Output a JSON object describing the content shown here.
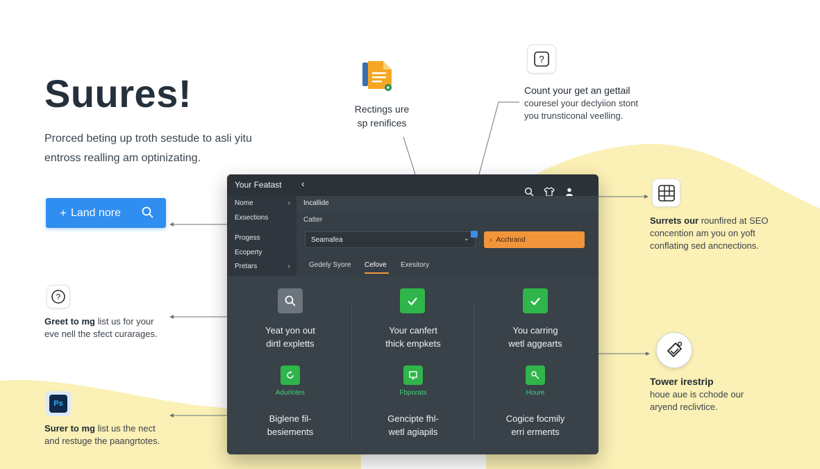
{
  "hero": {
    "title": "Suures!",
    "subtitle": "Prorced beting up troth sestude to asli yitu entross realling am optinizating.",
    "cta_label": "Land nore"
  },
  "callouts": {
    "top_center": {
      "line1": "Rectings ure",
      "line2": "sp renifices"
    },
    "top_right": {
      "title": "Count your get an gettail",
      "line2": "couresel your declyiion stont",
      "line3": "you trunsticonal veelling."
    },
    "right_upper": {
      "title": "Surrets our",
      "title_rest": " rounfired at SEO",
      "line2": "concention am you on yoft",
      "line3": "conflating sed ancnections."
    },
    "right_lower": {
      "title": "Tower irestrip",
      "line2": "houe aue is cchode our",
      "line3": "aryend reclivtice."
    },
    "left_middle": {
      "title": "Greet to mg",
      "title_rest": " list us for your",
      "line2": "eve nell the sfect curarages."
    },
    "left_bottom": {
      "title": "Surer to mg",
      "title_rest": " list us the nect",
      "line2": "and restuge the paangrtotes."
    }
  },
  "window": {
    "title": "Your Featast",
    "nav": [
      {
        "label": "Nome",
        "chevron": true
      },
      {
        "label": "Exsections",
        "chevron": false
      },
      {
        "label": "Progess",
        "chevron": false
      },
      {
        "label": "Ecoperty",
        "chevron": false
      },
      {
        "label": "Pretars",
        "chevron": true
      }
    ],
    "breadcrumb": "Incallide",
    "field_label": "Catter",
    "select_value": "Seamafea",
    "action_button": "Acchrand",
    "tabs": [
      {
        "label": "Gedely Syore",
        "active": false
      },
      {
        "label": "Cefove",
        "active": true
      },
      {
        "label": "Exesitory",
        "active": false
      }
    ],
    "cards": [
      {
        "title1": "Yeat yon out",
        "title2": "dirtl expletts",
        "badge": "Adurlotes",
        "footer1": "Biglene fil-",
        "footer2": "besiements"
      },
      {
        "title1": "Your canfert",
        "title2": "thick empkets",
        "badge": "Fbporats",
        "footer1": "Gencipte fhl-",
        "footer2": "wetl agiapils"
      },
      {
        "title1": "You carring",
        "title2": "wetl aggearts",
        "badge": "Houre",
        "footer1": "Cogice focmily",
        "footer2": "erri erments"
      }
    ]
  },
  "colors": {
    "accent_blue": "#2f8ef0",
    "accent_orange": "#f1953a",
    "accent_green": "#2fb54a",
    "wave_yellow": "#fbf0b5",
    "window_bg": "#363e46"
  }
}
